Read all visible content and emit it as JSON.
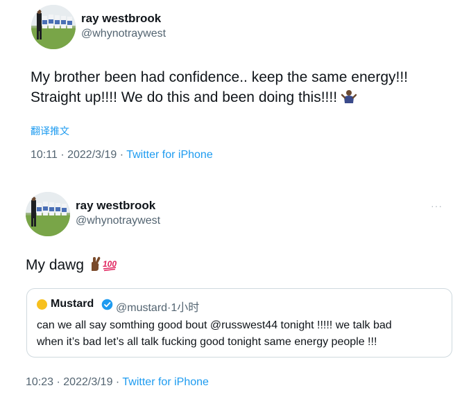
{
  "colors": {
    "link": "#1d9bf0",
    "secondary_text": "#536471",
    "primary_text": "#0f1419",
    "border": "#cfd9de"
  },
  "tweets": [
    {
      "author": {
        "name": "ray westbrook",
        "handle": "@whynotraywest"
      },
      "text_lines": [
        "My brother been had confidence.. keep the same energy!!!",
        "Straight up!!!! We do this and been doing this!!!!"
      ],
      "emoji": "shrug-icon",
      "translate_label": "翻译推文",
      "time": "10:11",
      "date": "2022/3/19",
      "source": "Twitter for iPhone",
      "separator": "·"
    },
    {
      "author": {
        "name": "ray westbrook",
        "handle": "@whynotraywest"
      },
      "text": "My dawg",
      "emojis": [
        "crossed-fingers-icon",
        "hundred-points-icon"
      ],
      "more_label": "···",
      "quote": {
        "name": "Mustard",
        "verified": "verified-badge-icon",
        "handle": "@mustard",
        "separator": "·",
        "age": "1小时",
        "text_lines": [
          "can we all say somthing good bout @russwest44 tonight !!!!! we talk bad",
          "when it’s bad let’s all talk fucking good tonight same energy people !!!"
        ]
      },
      "time": "10:23",
      "date": "2022/3/19",
      "source": "Twitter for iPhone",
      "separator": "·"
    }
  ]
}
